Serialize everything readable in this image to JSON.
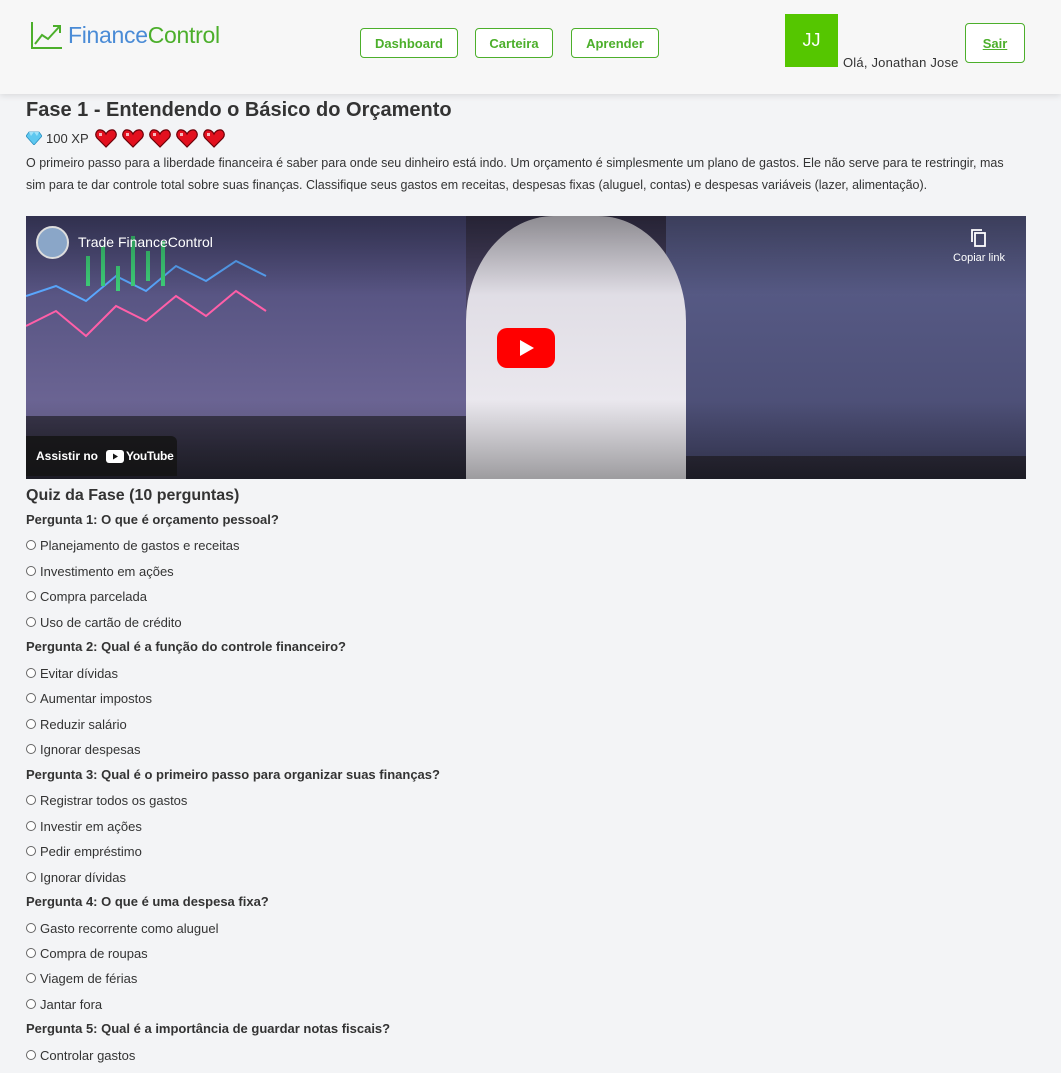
{
  "header": {
    "logo_part1": "Finance",
    "logo_part2": "Control",
    "nav": [
      {
        "label": "Dashboard"
      },
      {
        "label": "Carteira"
      },
      {
        "label": "Aprender"
      }
    ],
    "avatar_initials": "JJ",
    "greeting": "Olá, Jonathan Jose",
    "logout_label": "Sair",
    "colors": {
      "accent": "#4caf2b",
      "avatar": "#55c600",
      "logo_blue": "#4a8bd6"
    }
  },
  "phase": {
    "title": "Fase 1 - Entendendo o Básico do Orçamento",
    "xp": "100 XP",
    "hearts": 5,
    "description": "O primeiro passo para a liberdade financeira é saber para onde seu dinheiro está indo. Um orçamento é simplesmente um plano de gastos. Ele não serve para te restringir, mas sim para te dar controle total sobre suas finanças. Classifique seus gastos em receitas, despesas fixas (aluguel, contas) e despesas variáveis (lazer, alimentação)."
  },
  "video": {
    "channel": "Trade FinanceControl",
    "copy_link": "Copiar link",
    "watch_on": "Assistir no",
    "platform": "YouTube"
  },
  "quiz": {
    "title": "Quiz da Fase (10 perguntas)",
    "questions": [
      {
        "text": "Pergunta 1: O que é orçamento pessoal?",
        "options": [
          "Planejamento de gastos e receitas",
          "Investimento em ações",
          "Compra parcelada",
          "Uso de cartão de crédito"
        ]
      },
      {
        "text": "Pergunta 2: Qual é a função do controle financeiro?",
        "options": [
          "Evitar dívidas",
          "Aumentar impostos",
          "Reduzir salário",
          "Ignorar despesas"
        ]
      },
      {
        "text": "Pergunta 3: Qual é o primeiro passo para organizar suas finanças?",
        "options": [
          "Registrar todos os gastos",
          "Investir em ações",
          "Pedir empréstimo",
          "Ignorar dívidas"
        ]
      },
      {
        "text": "Pergunta 4: O que é uma despesa fixa?",
        "options": [
          "Gasto recorrente como aluguel",
          "Compra de roupas",
          "Viagem de férias",
          "Jantar fora"
        ]
      },
      {
        "text": "Pergunta 5: Qual é a importância de guardar notas fiscais?",
        "options": [
          "Controlar gastos"
        ]
      }
    ]
  }
}
